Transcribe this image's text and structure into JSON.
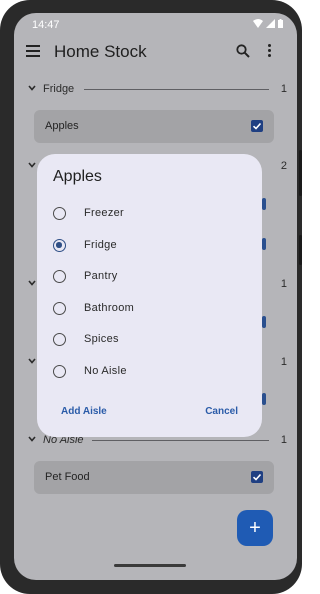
{
  "status_bar": {
    "time": "14:47",
    "icons": [
      "wifi-icon",
      "signal-icon",
      "battery-icon"
    ]
  },
  "app_bar": {
    "title": "Home Stock",
    "icons": [
      "menu-icon",
      "search-icon",
      "more-vert-icon"
    ]
  },
  "aisles": [
    {
      "name": "Fridge",
      "count": "1",
      "items": [
        {
          "name": "Apples",
          "checked": true
        }
      ]
    },
    {
      "name": "",
      "count": "2"
    },
    {
      "name": "",
      "count": "1"
    },
    {
      "name": "",
      "count": "1"
    },
    {
      "name": "No Aisle",
      "count": "1",
      "items": [
        {
          "name": "Pet Food",
          "checked": true
        }
      ]
    }
  ],
  "fab": {
    "label": "+"
  },
  "dialog": {
    "title": "Apples",
    "options": [
      {
        "label": "Freezer",
        "selected": false
      },
      {
        "label": "Fridge",
        "selected": true
      },
      {
        "label": "Pantry",
        "selected": false
      },
      {
        "label": "Bathroom",
        "selected": false
      },
      {
        "label": "Spices",
        "selected": false
      },
      {
        "label": "No Aisle",
        "selected": false
      }
    ],
    "add_label": "Add Aisle",
    "cancel_label": "Cancel"
  },
  "colors": {
    "scrim": "#b5b5b9",
    "dialog_bg": "#e9e8f4",
    "accent": "#2a5ba8",
    "checkbox": "#1f3f82",
    "fab": "#1f5bb4"
  }
}
